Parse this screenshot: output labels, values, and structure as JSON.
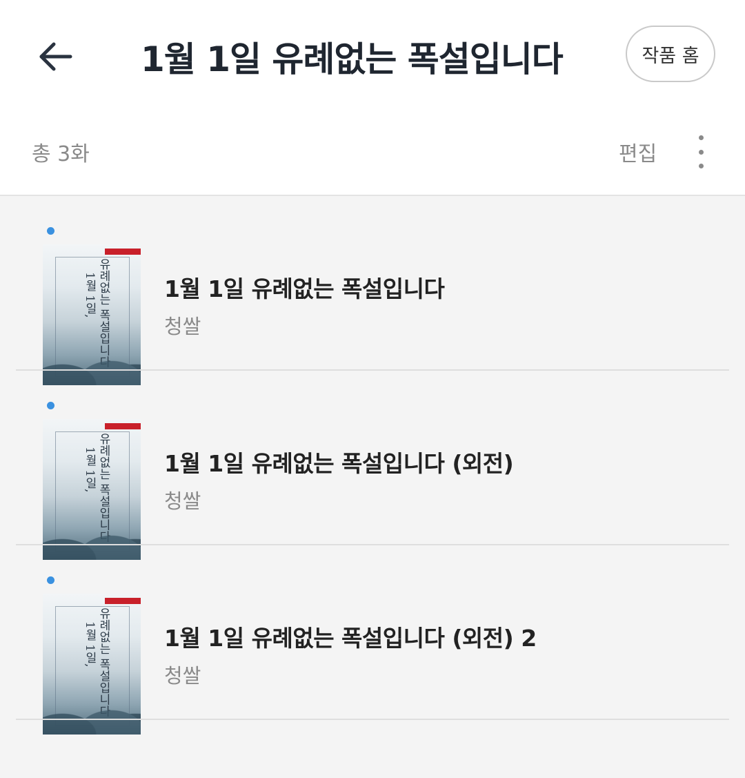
{
  "header": {
    "title": "1월 1일 유례없는 폭설입니다",
    "home_button": "작품 홈"
  },
  "subbar": {
    "total": "총 3화",
    "edit_label": "편집"
  },
  "episodes": [
    {
      "title": "1월 1일 유례없는 폭설입니다",
      "author": "청쌀",
      "is_new": true
    },
    {
      "title": "1월 1일 유례없는 폭설입니다 (외전)",
      "author": "청쌀",
      "is_new": true
    },
    {
      "title": "1월 1일 유례없는 폭설입니다 (외전) 2",
      "author": "청쌀",
      "is_new": true
    }
  ],
  "cover": {
    "vertical_title_part1": "1월 1일,",
    "vertical_title_part2": "유례없는 폭설입니다"
  },
  "colors": {
    "new_dot": "#3a91e0",
    "title_text": "#1f2630",
    "muted_text": "#8a8a8a"
  },
  "icons": {
    "back": "arrow-left-icon",
    "more": "more-vertical-icon"
  }
}
